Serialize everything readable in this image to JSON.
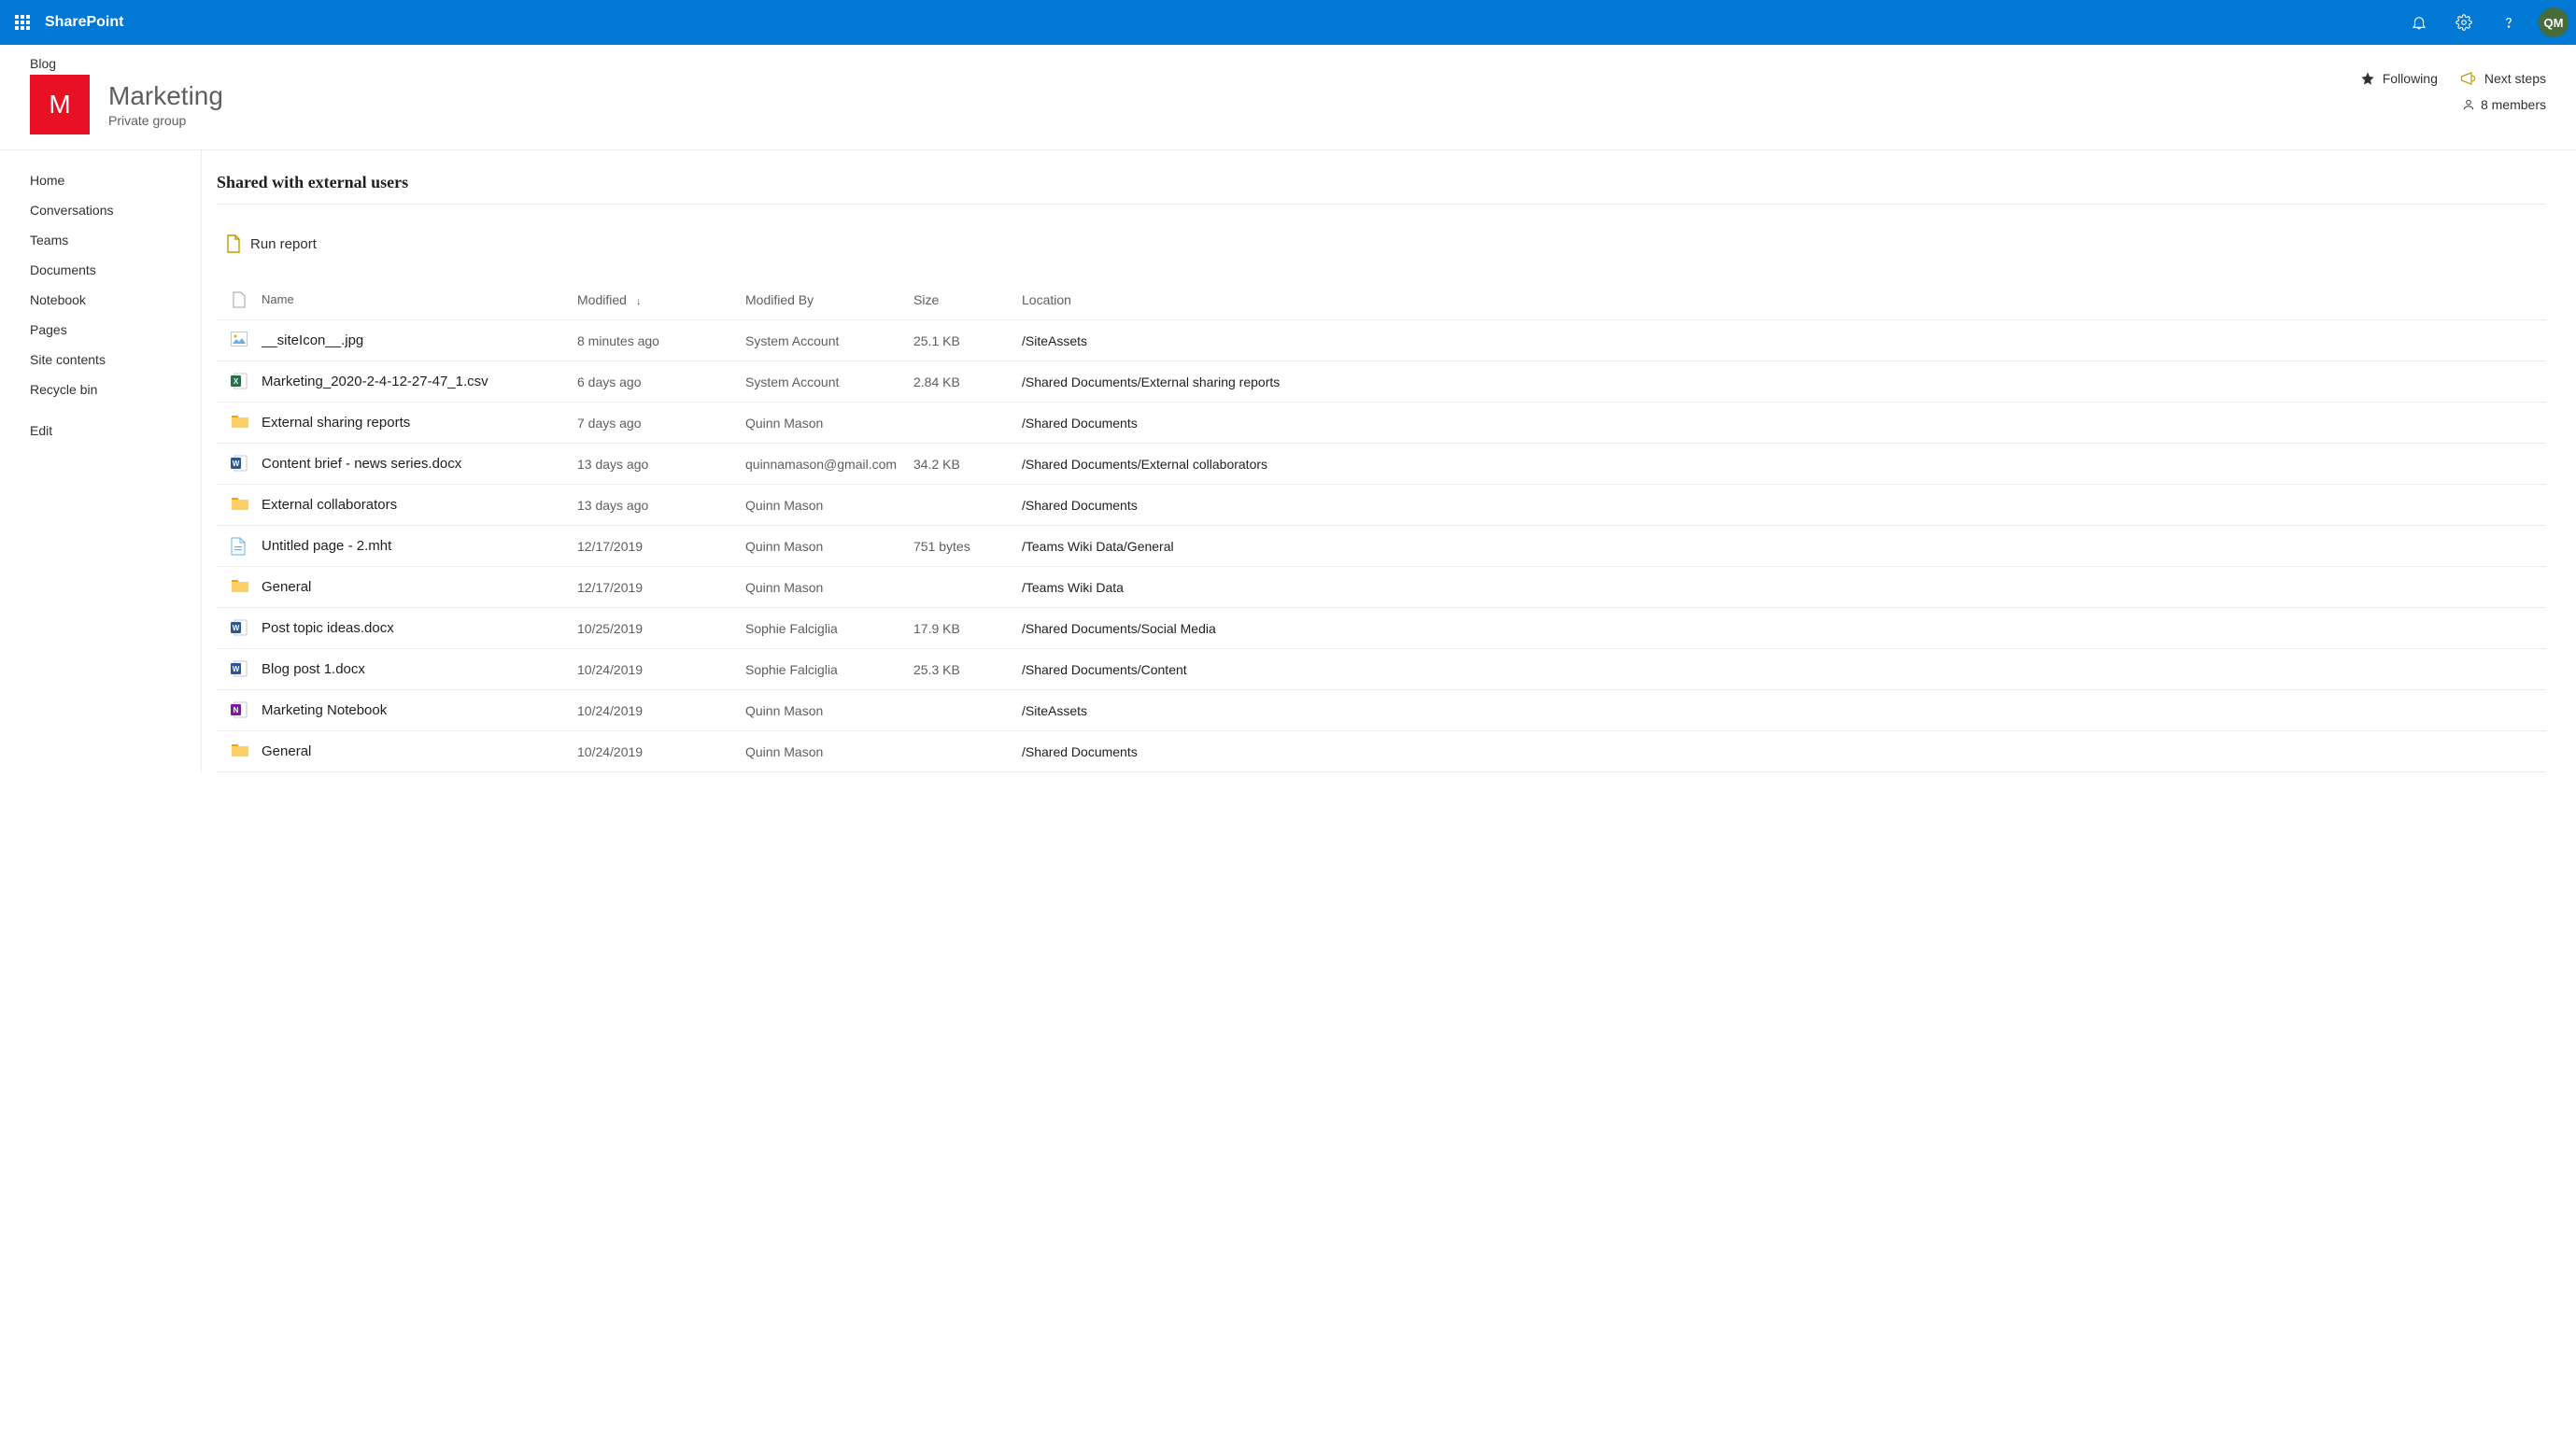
{
  "brand": "SharePoint",
  "avatar_initials": "QM",
  "breadcrumb": "Blog",
  "site": {
    "logo_letter": "M",
    "title": "Marketing",
    "subtitle": "Private group",
    "following_label": "Following",
    "next_steps_label": "Next steps",
    "members_label": "8 members"
  },
  "leftnav": {
    "items": [
      "Home",
      "Conversations",
      "Teams",
      "Documents",
      "Notebook",
      "Pages",
      "Site contents",
      "Recycle bin"
    ],
    "edit": "Edit"
  },
  "main": {
    "title": "Shared with external users",
    "run_report_label": "Run report",
    "columns": {
      "name": "Name",
      "modified": "Modified",
      "modified_by": "Modified By",
      "size": "Size",
      "location": "Location"
    },
    "rows": [
      {
        "icon": "image",
        "name": "__siteIcon__.jpg",
        "modified": "8 minutes ago",
        "modified_by": "System Account",
        "size": "25.1 KB",
        "location": "/SiteAssets"
      },
      {
        "icon": "excel",
        "name": "Marketing_2020-2-4-12-27-47_1.csv",
        "modified": "6 days ago",
        "modified_by": "System Account",
        "size": "2.84 KB",
        "location": "/Shared Documents/External sharing reports"
      },
      {
        "icon": "folder",
        "name": "External sharing reports",
        "modified": "7 days ago",
        "modified_by": "Quinn Mason",
        "size": "",
        "location": "/Shared Documents"
      },
      {
        "icon": "word",
        "name": "Content brief - news series.docx",
        "modified": "13 days ago",
        "modified_by": "quinnamason@gmail.com",
        "size": "34.2 KB",
        "location": "/Shared Documents/External collaborators"
      },
      {
        "icon": "folder",
        "name": "External collaborators",
        "modified": "13 days ago",
        "modified_by": "Quinn Mason",
        "size": "",
        "location": "/Shared Documents"
      },
      {
        "icon": "mht",
        "name": "Untitled page - 2.mht",
        "modified": "12/17/2019",
        "modified_by": "Quinn Mason",
        "size": "751 bytes",
        "location": "/Teams Wiki Data/General"
      },
      {
        "icon": "folder",
        "name": "General",
        "modified": "12/17/2019",
        "modified_by": "Quinn Mason",
        "size": "",
        "location": "/Teams Wiki Data"
      },
      {
        "icon": "word",
        "name": "Post topic ideas.docx",
        "modified": "10/25/2019",
        "modified_by": "Sophie Falciglia",
        "size": "17.9 KB",
        "location": "/Shared Documents/Social Media"
      },
      {
        "icon": "word",
        "name": "Blog post 1.docx",
        "modified": "10/24/2019",
        "modified_by": "Sophie Falciglia",
        "size": "25.3 KB",
        "location": "/Shared Documents/Content"
      },
      {
        "icon": "onenote",
        "name": "Marketing Notebook",
        "modified": "10/24/2019",
        "modified_by": "Quinn Mason",
        "size": "",
        "location": "/SiteAssets"
      },
      {
        "icon": "folder",
        "name": "General",
        "modified": "10/24/2019",
        "modified_by": "Quinn Mason",
        "size": "",
        "location": "/Shared Documents"
      }
    ]
  }
}
